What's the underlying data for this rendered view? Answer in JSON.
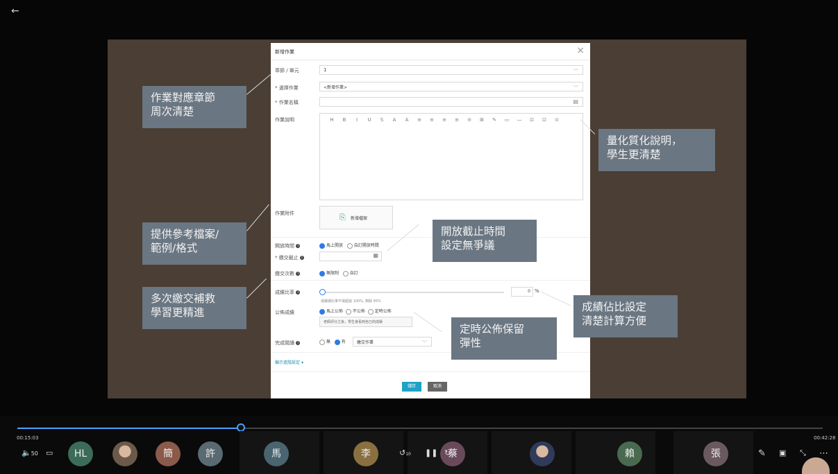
{
  "player": {
    "back_icon": "arrow-left-icon",
    "time_elapsed": "00:15:03",
    "time_total": "00:42:28",
    "volume": "50",
    "progress_fraction": 0.2777
  },
  "dialog": {
    "title": "新增作業",
    "close": "×",
    "fields": {
      "chapter_label": "章節 / 單元",
      "chapter_value": "1",
      "homework_label": "* 選擇作業",
      "homework_value": "<新增作業>",
      "name_label": "* 作業名稱",
      "desc_label": "作業說明",
      "attachment_label": "作業附件",
      "add_file_button": "新增檔案",
      "open_time_label": "開放時間",
      "open_now": "馬上開放",
      "open_custom": "自訂開放時間",
      "deadline_label": "* 繳交截止",
      "submit_times_label": "繳交次數",
      "submit_unlimited": "無限制",
      "submit_custom": "自訂",
      "score_ratio_label": "成績比率",
      "score_value": "0",
      "score_unit": "%",
      "score_hint": "成績總比率不得超過 100%, 剩餘 95%",
      "publish_label": "公佈成績",
      "publish_now": "馬上公佈",
      "publish_no": "不公佈",
      "publish_scheduled": "定時公佈",
      "publish_note": "老師評分之後，學生會看到自己的成績",
      "done_label": "完成閱讀",
      "done_no": "無",
      "done_yes": "有",
      "done_select": "繳交作業",
      "advanced": "顯示進階設定"
    },
    "buttons": {
      "save": "儲存",
      "cancel": "取消"
    },
    "toolbar_glyphs": [
      "H",
      "B",
      "I",
      "U",
      "S",
      "A",
      "A",
      "≡",
      "≡",
      "≡",
      "≡",
      "⊝",
      "⊞",
      "✎",
      "▭",
      "—",
      "⊡",
      "⊡",
      "⊙"
    ]
  },
  "callouts": {
    "c1": "作業對應章節\n周次清楚",
    "c2": "量化質化說明，\n學生更清楚",
    "c3": "提供參考檔案/\n範例/格式",
    "c4": "開放截止時間\n設定無爭議",
    "c5": "多次繳交補救\n學習更精進",
    "c6": "成績佔比設定\n清楚計算方便",
    "c7": "定時公佈保留\n彈性"
  },
  "participants": [
    {
      "initials": "HL",
      "color": "#3d6b5a"
    },
    {
      "initials": "",
      "color": "#6b5a4a",
      "photo": true
    },
    {
      "initials": "簡",
      "color": "#8a5a4a"
    },
    {
      "initials": "許",
      "color": "#5a6a72"
    },
    {
      "initials": "馬",
      "color": "#4a6470"
    },
    {
      "initials": "李",
      "color": "#8a7040"
    },
    {
      "initials": "蔡",
      "color": "#6a4a5a"
    },
    {
      "initials": "",
      "color": "#303a5a",
      "photo": true
    },
    {
      "initials": "賴",
      "color": "#4a6a50"
    },
    {
      "initials": "張",
      "color": "#6a5a60"
    }
  ],
  "controls": {
    "captions_icon": "caption-icon",
    "rewind": "10",
    "pause_icon": "pause-icon",
    "forward": "30",
    "pen_icon": "pen-icon",
    "pip_icon": "pip-icon",
    "shrink_icon": "shrink-icon",
    "more": "⋯"
  }
}
